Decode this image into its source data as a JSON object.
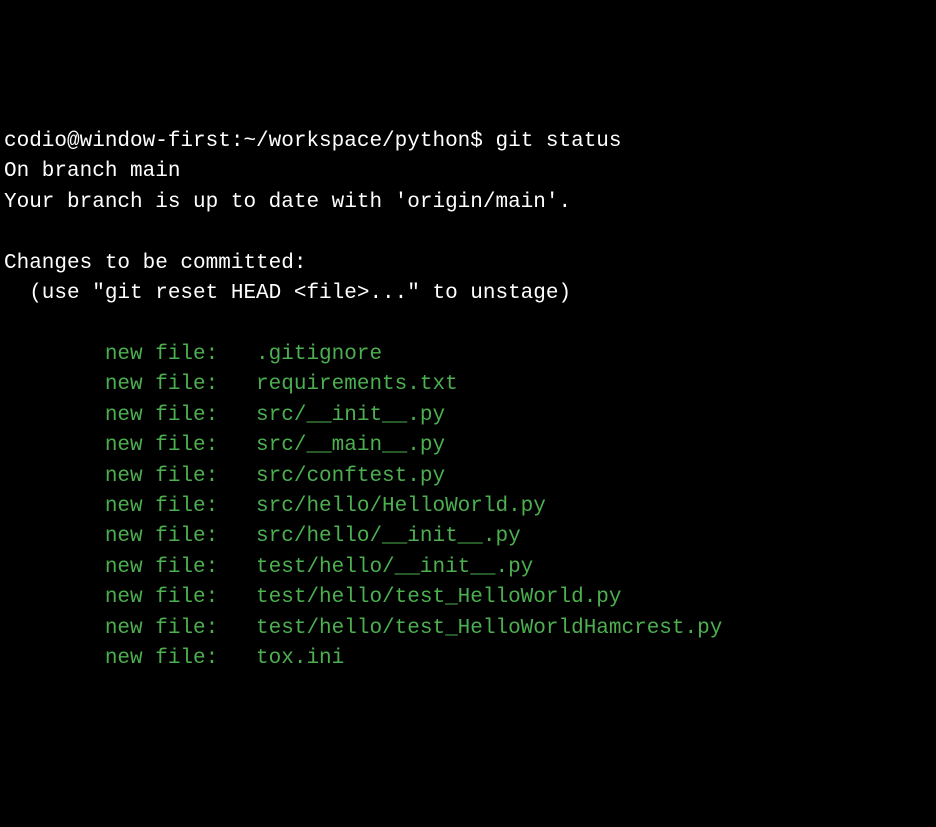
{
  "prompt": "codio@window-first:~/workspace/python$ ",
  "command": "git status",
  "status_lines": {
    "branch": "On branch main",
    "upstream": "Your branch is up to date with 'origin/main'.",
    "section_header": "Changes to be committed:",
    "hint": "  (use \"git reset HEAD <file>...\" to unstage)"
  },
  "staged_files": [
    {
      "label": "new file:",
      "path": ".gitignore"
    },
    {
      "label": "new file:",
      "path": "requirements.txt"
    },
    {
      "label": "new file:",
      "path": "src/__init__.py"
    },
    {
      "label": "new file:",
      "path": "src/__main__.py"
    },
    {
      "label": "new file:",
      "path": "src/conftest.py"
    },
    {
      "label": "new file:",
      "path": "src/hello/HelloWorld.py"
    },
    {
      "label": "new file:",
      "path": "src/hello/__init__.py"
    },
    {
      "label": "new file:",
      "path": "test/hello/__init__.py"
    },
    {
      "label": "new file:",
      "path": "test/hello/test_HelloWorld.py"
    },
    {
      "label": "new file:",
      "path": "test/hello/test_HelloWorldHamcrest.py"
    },
    {
      "label": "new file:",
      "path": "tox.ini"
    }
  ],
  "indent": "        ",
  "label_pad_width": 12
}
